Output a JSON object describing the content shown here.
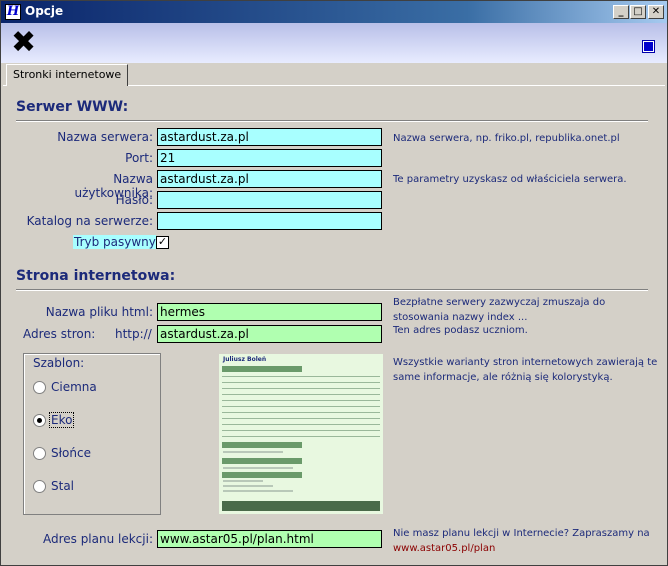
{
  "window": {
    "title": "Opcje",
    "app_icon": "H"
  },
  "toolbar": {
    "close_icon": "close-icon",
    "indicator_color": "#0000cc"
  },
  "tabs": [
    {
      "label": "Stronki internetowe"
    }
  ],
  "server": {
    "heading": "Serwer WWW:",
    "server_name_label": "Nazwa serwera:",
    "server_name_value": "astardust.za.pl",
    "port_label": "Port:",
    "port_value": "21",
    "username_label": "Nazwa użytkownika:",
    "username_value": "astardust.za.pl",
    "password_label": "Hasło:",
    "password_value": "",
    "folder_label": "Katalog na serwerze:",
    "folder_value": "",
    "passive_label": "Tryb pasywny",
    "passive_checked": "✓",
    "note_server": "Nazwa serwera, np. friko.pl, republika.onet.pl",
    "note_params": "Te parametry uzyskasz od właściciela serwera."
  },
  "site": {
    "heading": "Strona internetowa:",
    "filename_label": "Nazwa pliku html:",
    "filename_value": "hermes",
    "address_label": "Adres stron:",
    "address_prefix": "http://",
    "address_value": "astardust.za.pl",
    "note_filename": "Bezpłatne serwery zazwyczaj zmuszaja do stosowania nazwy index ...",
    "note_address": "Ten adres podasz uczniom.",
    "template_group_label": "Szablon:",
    "templates": [
      {
        "label": "Ciemna",
        "selected": false
      },
      {
        "label": "Eko",
        "selected": true
      },
      {
        "label": "Słońce",
        "selected": false
      },
      {
        "label": "Stal",
        "selected": false
      }
    ],
    "note_templates": "Wszystkie warianty stron internetowych zawierają te same informacje, ale różnią się kolorystyką.",
    "preview_title": "Juliusz Boleń",
    "plan_label": "Adres planu lekcji:",
    "plan_value": "www.astar05.pl/plan.html",
    "note_plan": "Nie masz planu lekcji w Internecie? Zapraszamy na",
    "note_plan_link": "www.astar05.pl/plan"
  },
  "colors": {
    "server_input": "#a8ffff",
    "site_input": "#b0ffb0",
    "label_text": "#1c2a7a",
    "link": "#8b0000"
  }
}
